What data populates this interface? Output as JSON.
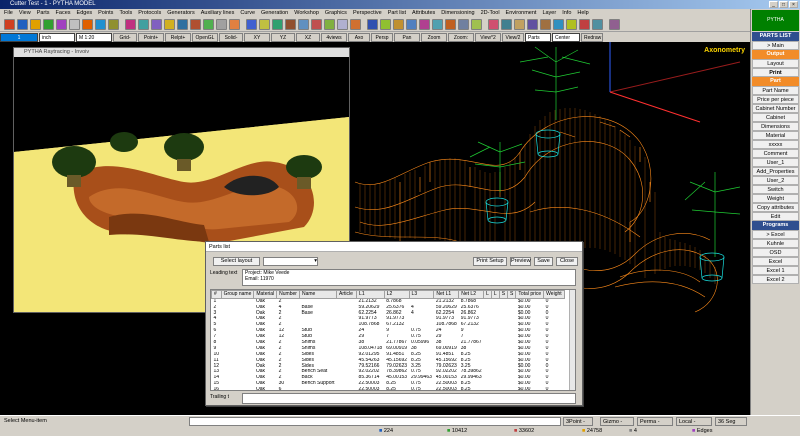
{
  "window": {
    "title": "Cutter Test - 1 - PYTHA MODEL",
    "controls": [
      "_",
      "□",
      "×"
    ]
  },
  "menu": [
    "File",
    "View",
    "Parts",
    "Faces",
    "Edges",
    "Points",
    "Tools",
    "Protocols",
    "Generators",
    "Auxiliary lines",
    "Curve",
    "Generation",
    "Workshop",
    "Graphics",
    "Perspective",
    "Part list",
    "Attributes",
    "Dimensioning",
    "2D-Tool",
    "Environment",
    "Layer",
    "Info",
    "Help"
  ],
  "toolbar2": {
    "layer": "1",
    "units": "inch",
    "scale": "M 1:20",
    "buttons": [
      "Grid-",
      "Point+",
      "Relpt+",
      "OpenGL",
      "Solid-",
      "XY",
      "YZ",
      "XZ",
      "4views",
      "Axo",
      "Persp",
      "Pan",
      "Zoom",
      "Zoom:",
      "View*2",
      "View/2"
    ],
    "view_combo": "Parts",
    "center": "Center",
    "redraw": "Redraw"
  },
  "viewport": {
    "label": "Axonometry"
  },
  "render_window": {
    "title": "PYTHA Raytracing - Invoiv"
  },
  "sidebar": {
    "logo": "PYTHA",
    "sections": [
      {
        "header": "PARTS LIST",
        "items": [
          "> Main"
        ]
      },
      {
        "header": "Output",
        "items": [
          "Layout",
          "Print"
        ]
      },
      {
        "header": "Part",
        "items": [
          "Part Name",
          "Price per piece",
          "Cabinet Number",
          "Cabinet",
          "Dimensions",
          "Material",
          "xxxxx",
          "Comment",
          "User_1",
          "Add_Properties",
          "User_2",
          "Switch",
          "Weight",
          "Copy attributes",
          "Edit"
        ]
      },
      {
        "header": "Programs",
        "items": [
          "> Excel",
          "Kuhnle",
          "OSD",
          "Excel",
          "Excel 1",
          "Excel 2"
        ]
      }
    ]
  },
  "parts_list": {
    "title": "Parts list",
    "select_layout": "Select layout",
    "buttons": [
      "Print Setup",
      "Preview",
      "Save",
      "Close"
    ],
    "leading_label": "Leading text",
    "leading_lines": [
      "Project: Mike Veede",
      "Email: 11970"
    ],
    "trailing_label": "Trailing t",
    "columns": [
      "#",
      "Group name",
      "Material",
      "Number",
      "Name",
      "Article",
      "L1",
      "L2",
      "L3",
      "Net L1",
      "Net L2",
      "L",
      "L",
      "S",
      "S",
      "Total price",
      "Weight"
    ],
    "rows": [
      [
        "1",
        "",
        "Oak",
        "2",
        "",
        "",
        "21.2132",
        "8.7868",
        "",
        "21.2132",
        "8.7868",
        "",
        "",
        "",
        "",
        "$0.00",
        "0"
      ],
      [
        "2",
        "",
        "Oak",
        "4",
        "Base",
        "",
        "59.20629",
        "25.6376",
        "4",
        "59.20629",
        "25.6376",
        "",
        "",
        "",
        "",
        "$0.00",
        "0"
      ],
      [
        "3",
        "",
        "Oak",
        "2",
        "Base",
        "",
        "62.2254",
        "26.862",
        "4",
        "62.2254",
        "26.862",
        "",
        "",
        "",
        "",
        "$0.00",
        "0"
      ],
      [
        "4",
        "",
        "Oak",
        "2",
        "",
        "",
        "91.9773",
        "91.9773",
        "",
        "91.9773",
        "91.9773",
        "",
        "",
        "",
        "",
        "$0.00",
        "0"
      ],
      [
        "5",
        "",
        "Oak",
        "2",
        "",
        "",
        "108.7868",
        "67.2132",
        "",
        "108.7868",
        "67.2132",
        "",
        "",
        "",
        "",
        "$0.00",
        "0"
      ],
      [
        "6",
        "",
        "Oak",
        "12",
        "Stud",
        "",
        "24",
        "9",
        "0.75",
        "24",
        "9",
        "",
        "",
        "",
        "",
        "$0.00",
        "0"
      ],
      [
        "7",
        "",
        "Oak",
        "12",
        "Stud",
        "",
        "29",
        "7",
        "0.75",
        "29",
        "7",
        "",
        "",
        "",
        "",
        "$0.00",
        "0"
      ],
      [
        "8",
        "",
        "Oak",
        "2",
        "Shims",
        "",
        "38",
        "21.77867",
        "0.05996",
        "38",
        "21.77867",
        "",
        "",
        "",
        "",
        "$0.00",
        "0"
      ],
      [
        "9",
        "",
        "Oak",
        "2",
        "Shims",
        "",
        "108.04718",
        "69.00919",
        "38",
        "69.00919",
        "38",
        "",
        "",
        "",
        "",
        "$0.00",
        "0"
      ],
      [
        "10",
        "",
        "Oak",
        "2",
        "Sides",
        "",
        "92.01295",
        "91.4851",
        "8.25",
        "91.4851",
        "8.25",
        "",
        "",
        "",
        "",
        "$0.00",
        "0"
      ],
      [
        "11",
        "",
        "Oak",
        "2",
        "Sides",
        "",
        "45.54263",
        "45.15692",
        "8.25",
        "45.15692",
        "8.25",
        "",
        "",
        "",
        "",
        "$0.00",
        "0"
      ],
      [
        "12",
        "",
        "Oak",
        "2",
        "Sides",
        "",
        "79.52166",
        "79.02623",
        "3.25",
        "79.02623",
        "3.25",
        "",
        "",
        "",
        "",
        "$0.00",
        "0"
      ],
      [
        "13",
        "",
        "Oak",
        "2",
        "Bench Seat",
        "",
        "92.02202",
        "78.39862",
        "0.75",
        "92.02202",
        "78.39862",
        "",
        "",
        "",
        "",
        "$0.00",
        "0"
      ],
      [
        "14",
        "",
        "Oak",
        "2",
        "Back",
        "",
        "85.36714",
        "45.00153",
        "29.99463",
        "45.00153",
        "29.99463",
        "",
        "",
        "",
        "",
        "$0.00",
        "0"
      ],
      [
        "15",
        "",
        "Oak",
        "30",
        "Bench Support",
        "",
        "22.50003",
        "8.25",
        "0.75",
        "22.50003",
        "8.25",
        "",
        "",
        "",
        "",
        "$0.00",
        "0"
      ],
      [
        "16",
        "",
        "Oak",
        "6",
        "",
        "",
        "22.50003",
        "8.25",
        "0.75",
        "22.50003",
        "8.25",
        "",
        "",
        "",
        "",
        "$0.00",
        "0"
      ]
    ]
  },
  "status": {
    "left": "Select Menu-item",
    "fields": [
      "3Point -",
      "Gizmo -",
      "Perma -",
      "Local -",
      "36 Seg"
    ],
    "counts": [
      "224",
      "10412",
      "33602",
      "24758",
      "4",
      "Edges"
    ]
  }
}
